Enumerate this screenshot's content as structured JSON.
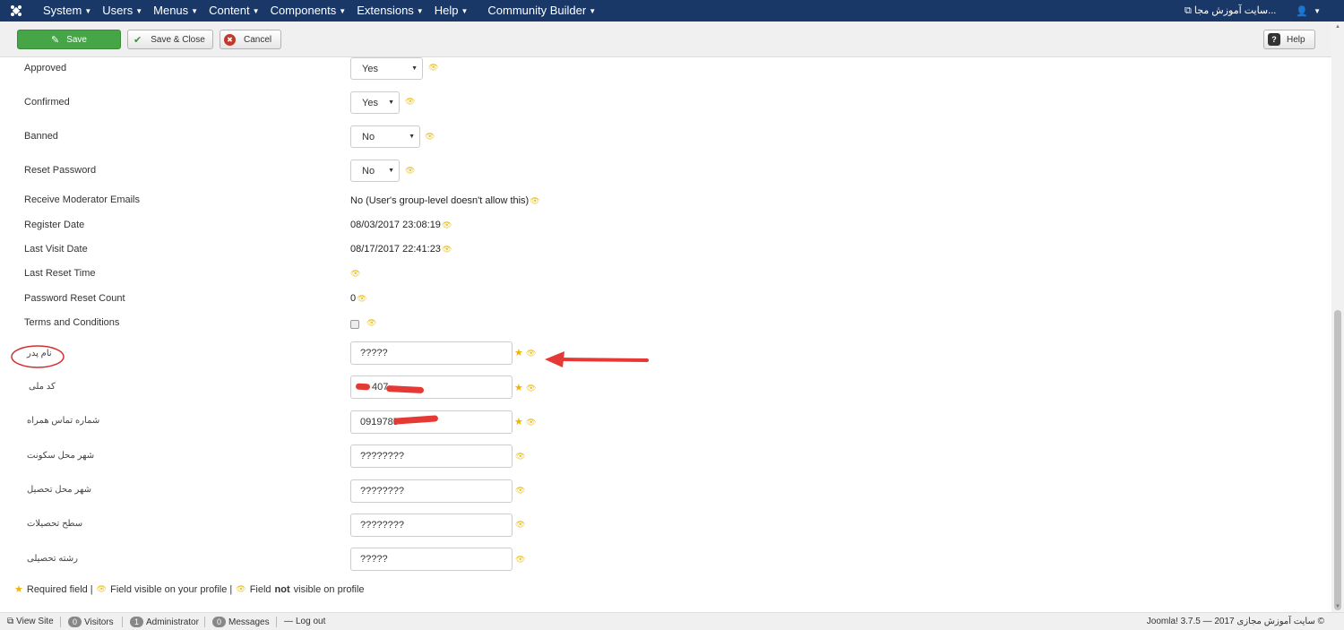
{
  "navbar": {
    "logo_icon": "joomla-icon",
    "menu": [
      {
        "label": "System"
      },
      {
        "label": "Users"
      },
      {
        "label": "Menus"
      },
      {
        "label": "Content"
      },
      {
        "label": "Components"
      },
      {
        "label": "Extensions"
      },
      {
        "label": "Help"
      },
      {
        "label": "Community Builder"
      }
    ],
    "site_link": "سایت آموزش مجا...",
    "user_icon": "user-icon"
  },
  "toolbar": {
    "save_label": "Save",
    "save_close_label": "Save & Close",
    "cancel_label": "Cancel",
    "help_label": "Help"
  },
  "form": {
    "approved": {
      "label": "Approved",
      "value": "Yes"
    },
    "confirmed": {
      "label": "Confirmed",
      "value": "Yes"
    },
    "banned": {
      "label": "Banned",
      "value": "No"
    },
    "reset_password": {
      "label": "Reset Password",
      "value": "No"
    },
    "receive_moderator_emails": {
      "label": "Receive Moderator Emails",
      "value": "No (User's group-level doesn't allow this)"
    },
    "register_date": {
      "label": "Register Date",
      "value": "08/03/2017 23:08:19"
    },
    "last_visit_date": {
      "label": "Last Visit Date",
      "value": "08/17/2017 22:41:23"
    },
    "last_reset_time": {
      "label": "Last Reset Time",
      "value": ""
    },
    "password_reset_count": {
      "label": "Password Reset Count",
      "value": "0"
    },
    "terms_and_conditions": {
      "label": "Terms and Conditions",
      "checked": false
    },
    "father_name": {
      "label": "نام پدر",
      "value": "?????"
    },
    "national_code": {
      "label": "کد ملی",
      "value": "407"
    },
    "mobile_number": {
      "label": "شماره تماس همراه",
      "value": "0919785"
    },
    "residence_city": {
      "label": "شهر محل سکونت",
      "value": "????????"
    },
    "study_city": {
      "label": "شهر محل تحصیل",
      "value": "????????"
    },
    "education_level": {
      "label": "سطح تحصیلات",
      "value": "????????"
    },
    "field_of_study": {
      "label": "رشته تحصیلی",
      "value": "?????"
    }
  },
  "legend": {
    "required": "Required field |",
    "visible": "Field visible on your profile |",
    "not_visible_prefix": "Field",
    "not_visible_bold": "not",
    "not_visible_suffix": "visible on profile"
  },
  "footer": {
    "view_site": "View Site",
    "visitors_count": "0",
    "visitors_label": "Visitors",
    "admin_count": "1",
    "admin_label": "Administrator",
    "messages_count": "0",
    "messages_label": "Messages",
    "logout": "Log out",
    "copyright": "Joomla! 3.7.5 — سایت آموزش مجازی 2017 ©"
  },
  "colors": {
    "navbar_bg": "#1a3867",
    "save_green": "#46a546",
    "eye_yellow": "#e8c020",
    "star_yellow": "#f2b400",
    "annotation_red": "#d32f2f"
  }
}
